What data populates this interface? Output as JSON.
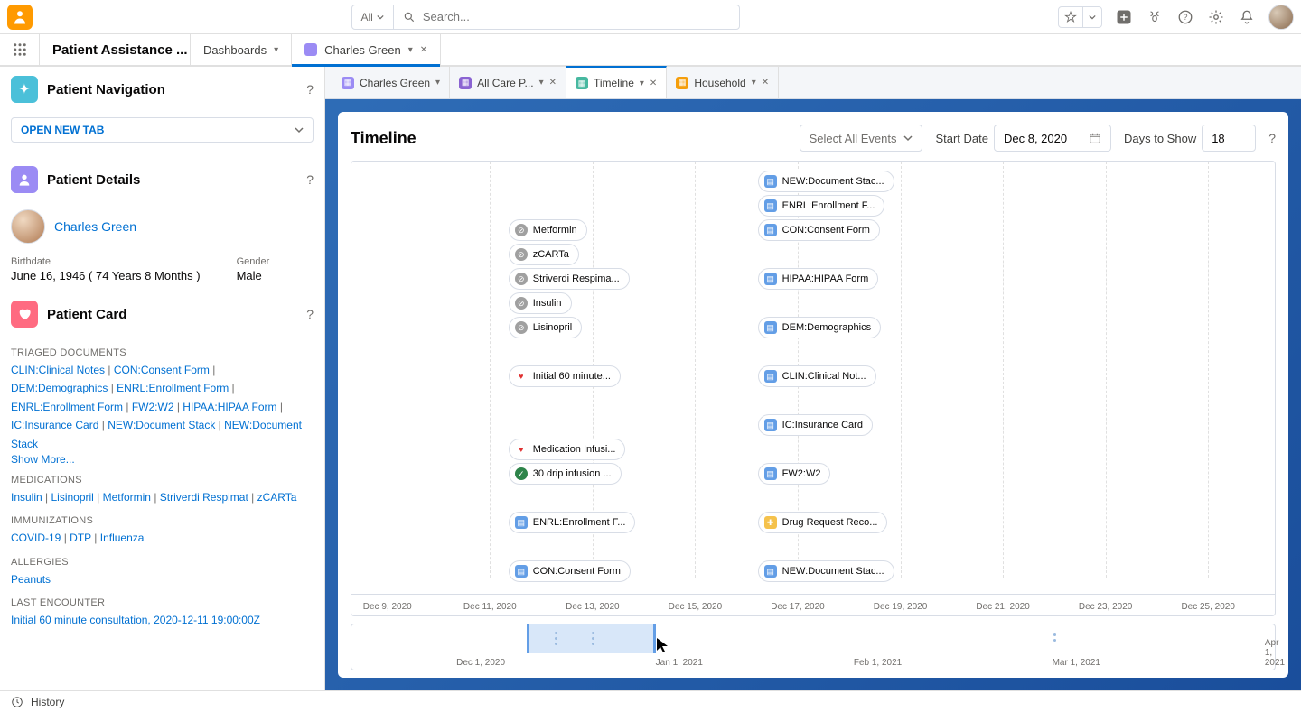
{
  "global": {
    "search_scope": "All",
    "search_placeholder": "Search..."
  },
  "nav": {
    "app_name": "Patient Assistance ...",
    "items": [
      {
        "label": "Dashboards",
        "has_chevron": true,
        "has_close": false,
        "active": false
      },
      {
        "label": "Charles Green",
        "has_chevron": true,
        "has_close": true,
        "active": true,
        "icon": "contact"
      }
    ]
  },
  "subtabs": [
    {
      "label": "Charles Green",
      "active": false,
      "icon": "contact",
      "closable": false
    },
    {
      "label": "All Care P...",
      "active": false,
      "icon": "plan",
      "closable": true
    },
    {
      "label": "Timeline",
      "active": true,
      "icon": "timeline",
      "closable": true
    },
    {
      "label": "Household",
      "active": false,
      "icon": "household",
      "closable": true
    }
  ],
  "left": {
    "nav_title": "Patient Navigation",
    "open_tab": "OPEN NEW TAB",
    "details_title": "Patient Details",
    "patient_name": "Charles Green",
    "birthdate_label": "Birthdate",
    "birthdate_value": "June 16, 1946 ( 74 Years 8 Months )",
    "gender_label": "Gender",
    "gender_value": "Male",
    "card_title": "Patient Card",
    "triaged_label": "TRIAGED DOCUMENTS",
    "triaged": [
      "CLIN:Clinical Notes",
      "CON:Consent Form",
      "DEM:Demographics",
      "ENRL:Enrollment Form",
      "ENRL:Enrollment Form",
      "FW2:W2",
      "HIPAA:HIPAA Form",
      "IC:Insurance Card",
      "NEW:Document Stack",
      "NEW:Document Stack"
    ],
    "show_more": "Show More...",
    "meds_label": "MEDICATIONS",
    "meds": [
      "Insulin",
      "Lisinopril",
      "Metformin",
      "Striverdi Respimat",
      "zCARTa"
    ],
    "imm_label": "IMMUNIZATIONS",
    "imm": [
      "COVID-19",
      "DTP",
      "Influenza"
    ],
    "allergies_label": "ALLERGIES",
    "allergies": [
      "Peanuts"
    ],
    "encounter_label": "LAST ENCOUNTER",
    "encounter": "Initial 60 minute consultation, 2020-12-11 19:00:00Z"
  },
  "timeline": {
    "title": "Timeline",
    "select_events": "Select All Events",
    "start_label": "Start Date",
    "start_value": "Dec 8, 2020",
    "days_label": "Days to Show",
    "days_value": "18",
    "axis": [
      "Dec 9, 2020",
      "Dec 11, 2020",
      "Dec 13, 2020",
      "Dec 15, 2020",
      "Dec 17, 2020",
      "Dec 19, 2020",
      "Dec 21, 2020",
      "Dec 23, 2020",
      "Dec 25, 2020"
    ],
    "events_col1": [
      {
        "type": "med",
        "label": "Metformin",
        "row": 2
      },
      {
        "type": "med",
        "label": "zCARTa",
        "row": 3
      },
      {
        "type": "med",
        "label": "Striverdi Respima...",
        "row": 4
      },
      {
        "type": "med",
        "label": "Insulin",
        "row": 5
      },
      {
        "type": "med",
        "label": "Lisinopril",
        "row": 6
      },
      {
        "type": "heart",
        "label": "Initial 60 minute...",
        "row": 8
      },
      {
        "type": "heart",
        "label": "Medication Infusi...",
        "row": 11
      },
      {
        "type": "check",
        "label": "30 drip infusion ...",
        "row": 12
      },
      {
        "type": "doc",
        "label": "ENRL:Enrollment F...",
        "row": 14
      },
      {
        "type": "doc",
        "label": "CON:Consent Form",
        "row": 16
      }
    ],
    "events_col2": [
      {
        "type": "doc",
        "label": "NEW:Document Stac...",
        "row": 0
      },
      {
        "type": "doc",
        "label": "ENRL:Enrollment F...",
        "row": 1
      },
      {
        "type": "doc",
        "label": "CON:Consent Form",
        "row": 2
      },
      {
        "type": "doc",
        "label": "HIPAA:HIPAA Form",
        "row": 4
      },
      {
        "type": "doc",
        "label": "DEM:Demographics",
        "row": 6
      },
      {
        "type": "doc",
        "label": "CLIN:Clinical Not...",
        "row": 8
      },
      {
        "type": "doc",
        "label": "IC:Insurance Card",
        "row": 10
      },
      {
        "type": "doc",
        "label": "FW2:W2",
        "row": 12
      },
      {
        "type": "drug",
        "label": "Drug Request Reco...",
        "row": 14
      },
      {
        "type": "doc",
        "label": "NEW:Document Stac...",
        "row": 16
      }
    ]
  },
  "overview": {
    "ticks": [
      "Dec 1, 2020",
      "Jan 1, 2021",
      "Feb 1, 2021",
      "Mar 1, 2021",
      "Apr 1, 2021"
    ]
  },
  "history": "History"
}
